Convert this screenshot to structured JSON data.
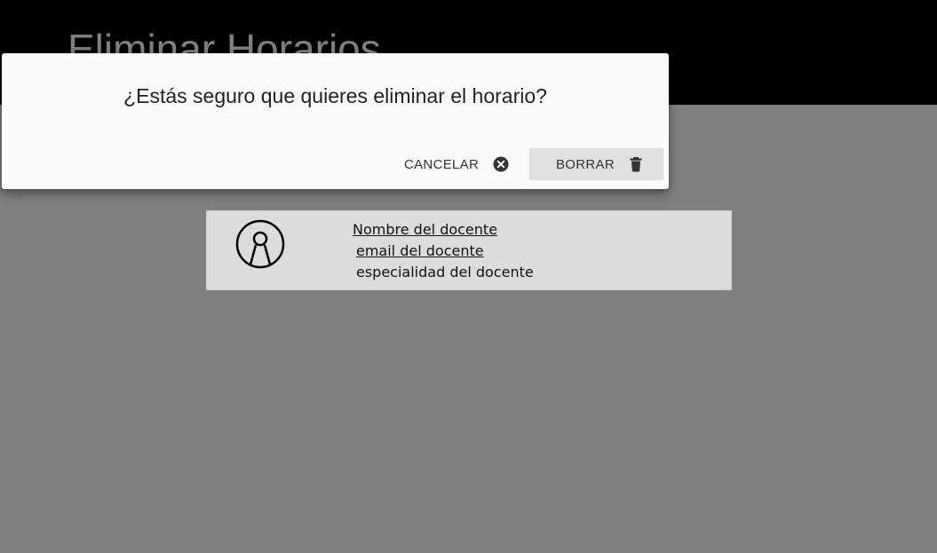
{
  "header": {
    "title": "Eliminar Horarios"
  },
  "teacher_card": {
    "name": "Nombre del docente",
    "email": "email del docente",
    "specialty": "especialidad del docente",
    "avatar_icon": "user-avatar-icon"
  },
  "dialog": {
    "message": "¿Estás seguro que quieres eliminar el horario?",
    "cancel_label": "CANCELAR",
    "cancel_icon": "close-circle-icon",
    "delete_label": "BORRAR",
    "delete_icon": "trash-icon"
  },
  "colors": {
    "header_bg": "#000000",
    "overlay_bg": "#808080",
    "dialog_bg": "#fafafa",
    "delete_button_bg": "#e0e0e0",
    "card_bg": "#dcdcdc"
  }
}
